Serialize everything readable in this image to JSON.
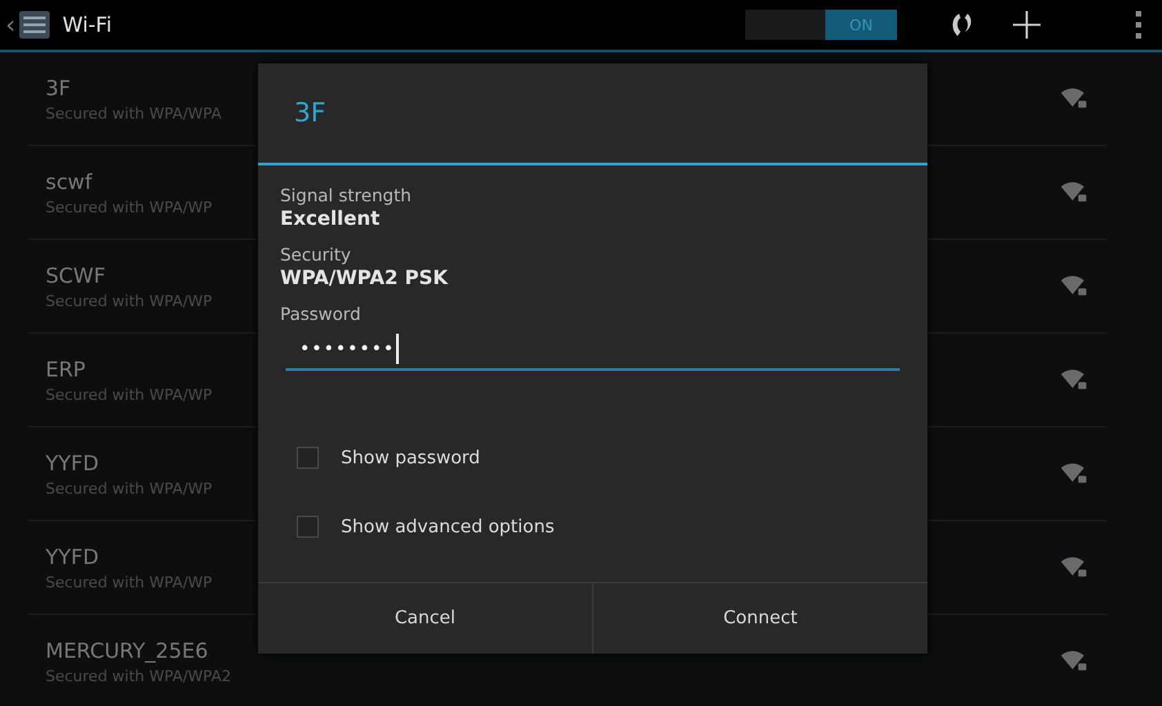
{
  "top_bar": {
    "back": "‹",
    "title": "Wi-Fi",
    "toggle": {
      "label": "ON",
      "on": true
    }
  },
  "networks": [
    {
      "name": "3F",
      "detail": "Secured with WPA/WPA"
    },
    {
      "name": "scwf",
      "detail": "Secured with WPA/WP"
    },
    {
      "name": "SCWF",
      "detail": "Secured with WPA/WP"
    },
    {
      "name": "ERP",
      "detail": "Secured with WPA/WP"
    },
    {
      "name": "YYFD",
      "detail": "Secured with WPA/WP"
    },
    {
      "name": "YYFD",
      "detail": "Secured with WPA/WP"
    },
    {
      "name": "MERCURY_25E6",
      "detail": "Secured with WPA/WPA2"
    }
  ],
  "dialog": {
    "title": "3F",
    "fields": [
      {
        "label": "Signal strength",
        "value": "Excellent"
      },
      {
        "label": "Security",
        "value": "WPA/WPA2 PSK"
      }
    ],
    "password": {
      "label": "Password",
      "value": "••••••••"
    },
    "checkboxes": [
      {
        "label": "Show password",
        "checked": false
      },
      {
        "label": "Show advanced options",
        "checked": false
      }
    ],
    "buttons": [
      "Cancel",
      "Connect"
    ]
  }
}
